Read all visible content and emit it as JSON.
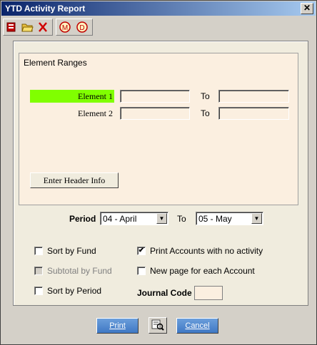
{
  "window": {
    "title": "YTD Activity Report",
    "close_glyph": "✕"
  },
  "toolbar": {
    "buttons": [
      {
        "name": "print-icon"
      },
      {
        "name": "open-folder-icon"
      },
      {
        "name": "delete-icon"
      },
      {
        "name": "m-circle-icon"
      },
      {
        "name": "d-circle-icon"
      }
    ],
    "m_glyph": "M",
    "d_glyph": "D"
  },
  "element_ranges": {
    "title": "Element Ranges",
    "rows": [
      {
        "label": "Element 1",
        "from": "",
        "to_label": "To",
        "to": ""
      },
      {
        "label": "Element 2",
        "from": "",
        "to_label": "To",
        "to": ""
      }
    ],
    "header_button": "Enter Header Info"
  },
  "period": {
    "label": "Period",
    "from": "04 - April",
    "to_label": "To",
    "to": "05 - May"
  },
  "options": {
    "sort_by_fund": {
      "label": "Sort by Fund",
      "checked": false
    },
    "subtotal_by_fund": {
      "label": "Subtotal by Fund",
      "checked": false,
      "disabled": true
    },
    "sort_by_period": {
      "label": "Sort by Period",
      "checked": false
    },
    "print_no_activity": {
      "label": "Print Accounts with no activity",
      "checked": true,
      "mark": "✔"
    },
    "new_page": {
      "label": "New page for each Account",
      "checked": false
    }
  },
  "journal_code": {
    "label": "Journal Code",
    "value": ""
  },
  "footer": {
    "print": "Print",
    "cancel": "Cancel"
  },
  "colors": {
    "highlight": "#80ff00",
    "title_start": "#0a246a",
    "button_blue": "#4a85cf"
  }
}
